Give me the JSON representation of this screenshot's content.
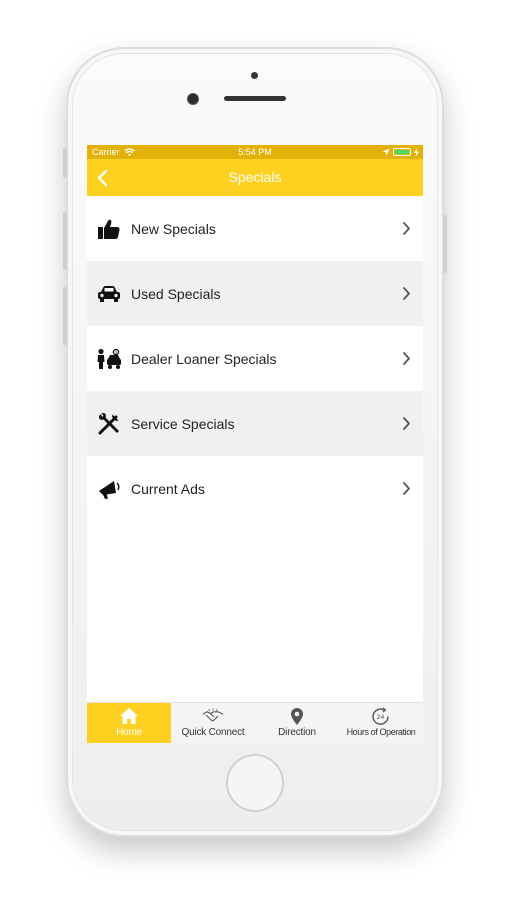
{
  "status_bar": {
    "carrier": "Carrier",
    "time": "5:54 PM"
  },
  "nav": {
    "title": "Specials",
    "back_icon": "chevron-left-icon"
  },
  "specials": [
    {
      "label": "New Specials",
      "icon": "thumbs-up-icon"
    },
    {
      "label": "Used Specials",
      "icon": "car-icon"
    },
    {
      "label": "Dealer Loaner Specials",
      "icon": "dealer-loaner-icon"
    },
    {
      "label": "Service Specials",
      "icon": "wrench-screwdriver-icon"
    },
    {
      "label": "Current Ads",
      "icon": "megaphone-icon"
    }
  ],
  "tabs": [
    {
      "label": "Home",
      "icon": "home-icon",
      "active": true
    },
    {
      "label": "Quick Connect",
      "icon": "handshake-icon",
      "active": false
    },
    {
      "label": "Direction",
      "icon": "location-pin-icon",
      "active": false
    },
    {
      "label": "Hours of Operation",
      "icon": "clock-24-icon",
      "active": false
    }
  ],
  "colors": {
    "accent": "#fed020",
    "status_bar": "#e2b20b",
    "alt_row": "#f0f0f0",
    "battery": "#4cd964"
  }
}
